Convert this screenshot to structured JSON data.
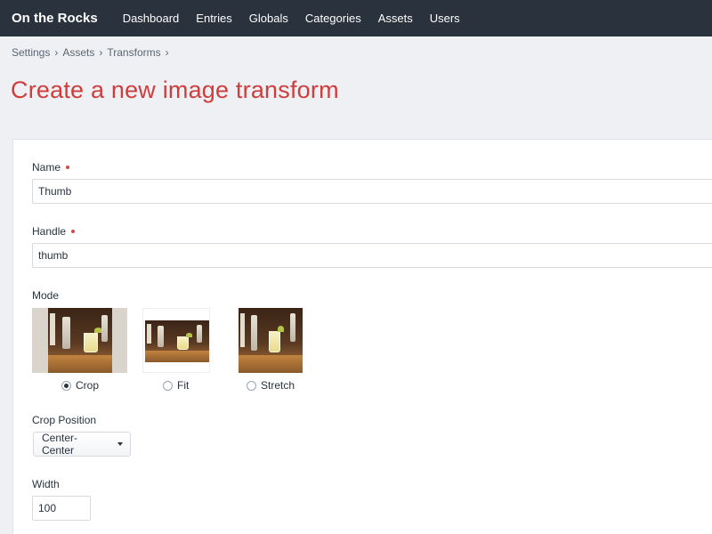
{
  "header": {
    "site_name": "On the Rocks",
    "nav": [
      "Dashboard",
      "Entries",
      "Globals",
      "Categories",
      "Assets",
      "Users"
    ]
  },
  "breadcrumb": [
    "Settings",
    "Assets",
    "Transforms"
  ],
  "page_title": "Create a new image transform",
  "form": {
    "name": {
      "label": "Name",
      "value": "Thumb",
      "required": true
    },
    "handle": {
      "label": "Handle",
      "value": "thumb",
      "required": true
    },
    "mode": {
      "label": "Mode",
      "options": [
        {
          "label": "Crop",
          "selected": true
        },
        {
          "label": "Fit",
          "selected": false
        },
        {
          "label": "Stretch",
          "selected": false
        }
      ]
    },
    "crop_position": {
      "label": "Crop Position",
      "value": "Center-Center"
    },
    "width": {
      "label": "Width",
      "value": "100"
    }
  },
  "colors": {
    "topbar": "#29323d",
    "title": "#cf3d3d",
    "required_dot": "#d24a4a"
  },
  "icons": {
    "select_caret": "chevron-down-icon",
    "required": "required-dot-icon"
  }
}
